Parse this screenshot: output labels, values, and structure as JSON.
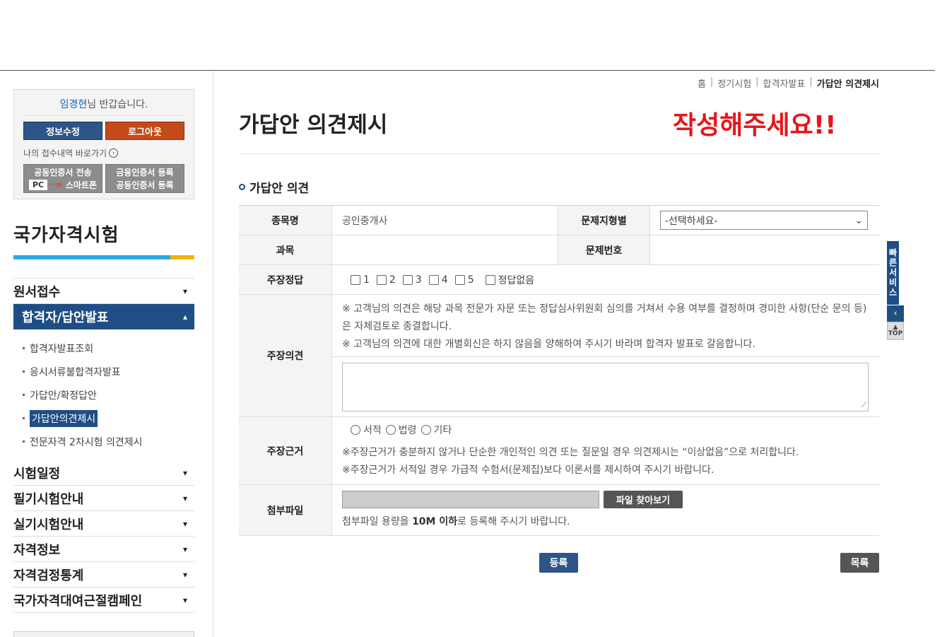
{
  "user": {
    "name": "임경현",
    "greeting_suffix": "님 반갑습니다."
  },
  "login_box": {
    "edit_label": "정보수정",
    "logout_label": "로그아웃",
    "receipt_link": "나의 접수내역 바로가기",
    "cert_send": "공동인증서 전송",
    "cert_pc": "PC",
    "cert_phone": "스마트폰",
    "cert_fin": "금융인증서 등록",
    "cert_joint": "공동인증서 등록"
  },
  "sidebar": {
    "title": "국가자격시험",
    "menu": [
      {
        "label": "원서접수"
      },
      {
        "label": "합격자/답안발표"
      },
      {
        "label": "시험일정"
      },
      {
        "label": "필기시험안내"
      },
      {
        "label": "실기시험안내"
      },
      {
        "label": "자격정보"
      },
      {
        "label": "자격검정통계"
      },
      {
        "label": "국가자격대여근절캠페인"
      }
    ],
    "submenu": [
      {
        "label": "합격자발표조회"
      },
      {
        "label": "응시서류불합격자발표"
      },
      {
        "label": "가답안/확정답안"
      },
      {
        "label": "가답안의견제시"
      },
      {
        "label": "전문자격 2차시험 의견제시"
      }
    ]
  },
  "breadcrumb": [
    "홈",
    "정기시험",
    "합격자발표",
    "가답안 의견제시"
  ],
  "page": {
    "title": "가답안 의견제시",
    "warning": "작성해주세요!!",
    "section": "가답안 의견"
  },
  "form": {
    "labels": {
      "category": "종목명",
      "type": "문제지형별",
      "subject": "과목",
      "qnum": "문제번호",
      "answer": "주장정답",
      "opinion": "주장의견",
      "basis": "주장근거",
      "attach": "첨부파일"
    },
    "category_value": "공인중개사",
    "type_select": "-선택하세요-",
    "answers": [
      "1",
      "2",
      "3",
      "4",
      "5"
    ],
    "no_answer": "정답없음",
    "opinion_note1": "※ 고객님의 의견은 해당 과목 전문가 자문 또는 정답심사위원회 심의를 거쳐서 수용 여부를 결정하며 경미한 사항(단순 문의 등)은 자체검토로 종결합니다.",
    "opinion_note2": "※ 고객님의 의견에 대한 개별회신은 하지 않음을 양해하여 주시기 바라며 합격자 발표로 갈음합니다.",
    "basis_options": [
      "서적",
      "법령",
      "기타"
    ],
    "basis_note1": "※주장근거가 충분하지 않거나 단순한 개인적인 의견 또는 질문일 경우 의견제시는 “이상없음”으로 처리합니다.",
    "basis_note2": "※주장근거가 서적일 경우 가급적 수험서(문제집)보다 이론서를 제시하여 주시기 바랍니다.",
    "file_button": "파일 찾아보기",
    "attach_note_pre": "첨부파일 용량을 ",
    "attach_note_bold": "10M 이하",
    "attach_note_post": "로 등록해 주시기 바랍니다."
  },
  "buttons": {
    "submit": "등록",
    "list": "목록"
  },
  "quick": {
    "label": "빠른서비스",
    "top": "TOP"
  }
}
